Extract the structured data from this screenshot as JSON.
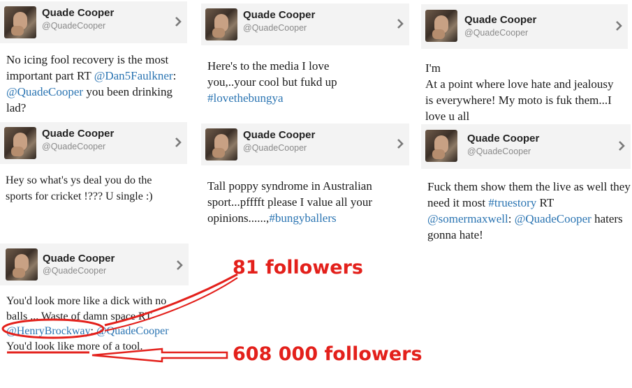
{
  "profile": {
    "name": "Quade Cooper",
    "handle": "@QuadeCooper"
  },
  "tweets": {
    "t1": {
      "a": "No icing fool recovery is the most important part RT ",
      "mention1": "@Dan5Faulkner",
      "b": ": ",
      "mention2": "@QuadeCooper",
      "c": " you been drinking lad?"
    },
    "t2": {
      "a": "Here's to the media I love you,..your cool but fukd up ",
      "tag": "#lovethebungya"
    },
    "t3": {
      "line1": "I'm",
      "line2": "At a point where love hate and jealousy is everywhere!  My moto is fuk them...I love u all"
    },
    "t4": {
      "a": "Hey so what's ys deal you do the sports for cricket !??? U single :)"
    },
    "t5": {
      "a": "Tall poppy syndrome in Australian sport...pfffft please I value all your opinions......,",
      "tag": "#bungyballers"
    },
    "t6": {
      "a": "Fuck them show them the live as well they need it most ",
      "tag": "#truestory",
      "b": " RT ",
      "mention1": "@somermaxwell",
      "c": ": ",
      "mention2": "@QuadeCooper",
      "d": " haters gonna hate!"
    },
    "t7": {
      "a": "You'd look more like a dick with no balls ... Waste of damn space RT ",
      "mention1": "@HenryBrockway",
      "b": ": ",
      "mention2": "@QuadeCooper",
      "c": " You'd look like more of a tool."
    }
  },
  "annotations": {
    "top": "81 followers",
    "bottom": "608 000 followers",
    "color": "#e3201b"
  },
  "colors": {
    "link": "#2a74b2",
    "header_bg": "#f3f3f3"
  },
  "icons": {
    "chevron": "chevron-right-icon",
    "avatar": "profile-photo"
  }
}
